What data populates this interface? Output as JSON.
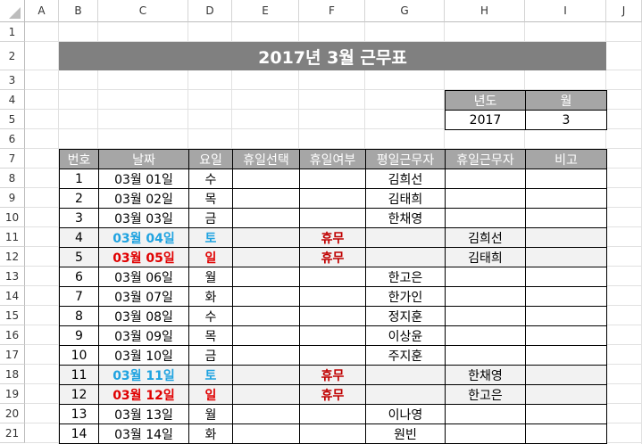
{
  "sheet": {
    "columns": [
      "A",
      "B",
      "C",
      "D",
      "E",
      "F",
      "G",
      "H",
      "I",
      "J"
    ],
    "rows": [
      "1",
      "2",
      "3",
      "4",
      "5",
      "6",
      "7",
      "8",
      "9",
      "10",
      "11",
      "12",
      "13",
      "14",
      "15",
      "16",
      "17",
      "18",
      "19",
      "20",
      "21"
    ]
  },
  "title": "2017년 3월 근무표",
  "year_month": {
    "year_label": "년도",
    "month_label": "월",
    "year": "2017",
    "month": "3"
  },
  "table": {
    "headers": [
      "번호",
      "날짜",
      "요일",
      "휴일선택",
      "휴일여부",
      "평일근무자",
      "휴일근무자",
      "비고"
    ],
    "rows": [
      {
        "no": "1",
        "date": "03월 01일",
        "day": "수",
        "holiday_select": "",
        "holiday_flag": "",
        "weekday_worker": "김희선",
        "holiday_worker": "",
        "note": "",
        "type": "weekday"
      },
      {
        "no": "2",
        "date": "03월 02일",
        "day": "목",
        "holiday_select": "",
        "holiday_flag": "",
        "weekday_worker": "김태희",
        "holiday_worker": "",
        "note": "",
        "type": "weekday"
      },
      {
        "no": "3",
        "date": "03월 03일",
        "day": "금",
        "holiday_select": "",
        "holiday_flag": "",
        "weekday_worker": "한채영",
        "holiday_worker": "",
        "note": "",
        "type": "weekday"
      },
      {
        "no": "4",
        "date": "03월 04일",
        "day": "토",
        "holiday_select": "",
        "holiday_flag": "휴무",
        "weekday_worker": "",
        "holiday_worker": "김희선",
        "note": "",
        "type": "sat"
      },
      {
        "no": "5",
        "date": "03월 05일",
        "day": "일",
        "holiday_select": "",
        "holiday_flag": "휴무",
        "weekday_worker": "",
        "holiday_worker": "김태희",
        "note": "",
        "type": "sun"
      },
      {
        "no": "6",
        "date": "03월 06일",
        "day": "월",
        "holiday_select": "",
        "holiday_flag": "",
        "weekday_worker": "한고은",
        "holiday_worker": "",
        "note": "",
        "type": "weekday"
      },
      {
        "no": "7",
        "date": "03월 07일",
        "day": "화",
        "holiday_select": "",
        "holiday_flag": "",
        "weekday_worker": "한가인",
        "holiday_worker": "",
        "note": "",
        "type": "weekday"
      },
      {
        "no": "8",
        "date": "03월 08일",
        "day": "수",
        "holiday_select": "",
        "holiday_flag": "",
        "weekday_worker": "정지훈",
        "holiday_worker": "",
        "note": "",
        "type": "weekday"
      },
      {
        "no": "9",
        "date": "03월 09일",
        "day": "목",
        "holiday_select": "",
        "holiday_flag": "",
        "weekday_worker": "이상윤",
        "holiday_worker": "",
        "note": "",
        "type": "weekday"
      },
      {
        "no": "10",
        "date": "03월 10일",
        "day": "금",
        "holiday_select": "",
        "holiday_flag": "",
        "weekday_worker": "주지훈",
        "holiday_worker": "",
        "note": "",
        "type": "weekday"
      },
      {
        "no": "11",
        "date": "03월 11일",
        "day": "토",
        "holiday_select": "",
        "holiday_flag": "휴무",
        "weekday_worker": "",
        "holiday_worker": "한채영",
        "note": "",
        "type": "sat"
      },
      {
        "no": "12",
        "date": "03월 12일",
        "day": "일",
        "holiday_select": "",
        "holiday_flag": "휴무",
        "weekday_worker": "",
        "holiday_worker": "한고은",
        "note": "",
        "type": "sun"
      },
      {
        "no": "13",
        "date": "03월 13일",
        "day": "월",
        "holiday_select": "",
        "holiday_flag": "",
        "weekday_worker": "이나영",
        "holiday_worker": "",
        "note": "",
        "type": "weekday"
      },
      {
        "no": "14",
        "date": "03월 14일",
        "day": "화",
        "holiday_select": "",
        "holiday_flag": "",
        "weekday_worker": "원빈",
        "holiday_worker": "",
        "note": "",
        "type": "weekday"
      }
    ]
  },
  "colors": {
    "title_bg": "#808080",
    "title_text": "#ffffff",
    "header_bg": "#a6a6a6",
    "label_bg": "#a6a6a6",
    "weekend_row_bg": "#f2f2f2",
    "saturday_text": "#1fa3e0",
    "sunday_text": "#e00000",
    "holiday_flag_text": "#c00000",
    "gridline": "#e1e1e1",
    "border": "#000000"
  }
}
